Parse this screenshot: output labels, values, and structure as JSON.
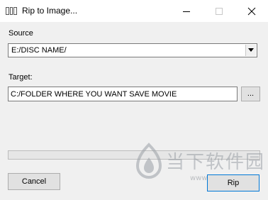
{
  "window": {
    "title": "Rip to Image..."
  },
  "source": {
    "label": "Source",
    "selected_value": "E:/DISC NAME/"
  },
  "target": {
    "label": "Target:",
    "value": "C:/FOLDER WHERE YOU WANT SAVE MOVIE",
    "browse_label": "..."
  },
  "progress": {
    "value": 0
  },
  "buttons": {
    "cancel_label": "Cancel",
    "rip_label": "Rip"
  },
  "watermark": {
    "brand_text": "当下软件园",
    "url_text": "www.downxia.com"
  }
}
